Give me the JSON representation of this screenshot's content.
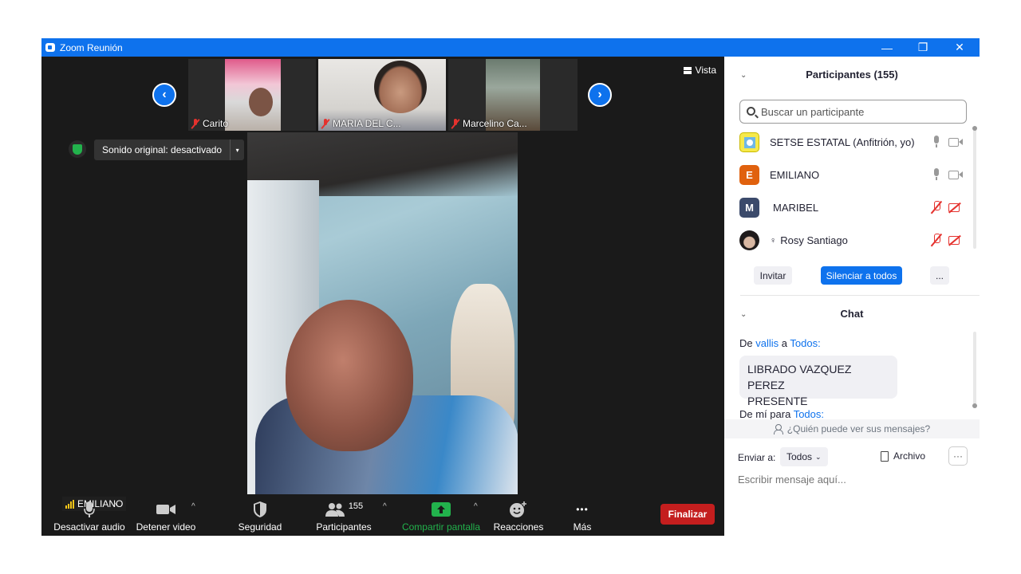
{
  "window": {
    "title": "Zoom Reunión",
    "minimize": "—",
    "restore": "❐",
    "close": "✕"
  },
  "gallery": {
    "prev": "‹",
    "next": "›",
    "thumbs": [
      {
        "name": "Carito"
      },
      {
        "name": "MARIA DEL C..."
      },
      {
        "name": "Marcelino Ca..."
      }
    ]
  },
  "view": {
    "label": "Vista"
  },
  "audio_pill": {
    "label": "Sonido original: desactivado",
    "dropdown": "▾"
  },
  "speaker": {
    "name": "EMILIANO"
  },
  "toolbar": {
    "mute": "Desactivar audio",
    "video": "Detener video",
    "security": "Seguridad",
    "participants": "Participantes",
    "participants_count": "155",
    "share": "Compartir pantalla",
    "reactions": "Reacciones",
    "more": "Más",
    "more_glyph": "•••",
    "caret": "^",
    "end": "Finalizar"
  },
  "participants_panel": {
    "title": "Participantes (155)",
    "search_placeholder": "Buscar un participante",
    "list": [
      {
        "name": "SETSE ESTATAL (Anfitrión, yo)",
        "initial": ""
      },
      {
        "name": "EMILIANO",
        "initial": "E"
      },
      {
        "name": "MARIBEL",
        "initial": "M"
      },
      {
        "name": "Rosy Santiago",
        "initial": ""
      }
    ],
    "invite": "Invitar",
    "mute_all": "Silenciar a todos",
    "more": "..."
  },
  "chat": {
    "title": "Chat",
    "msg1": {
      "prefix": "De",
      "from": "vallis",
      "mid": "a",
      "to": "Todos:",
      "text_l1": "LIBRADO VAZQUEZ PEREZ",
      "text_l2": "PRESENTE"
    },
    "msg2": {
      "prefix": "De mí para",
      "to": "Todos:"
    },
    "who_can_see": "¿Quién puede ver sus mensajes?",
    "send_to_label": "Enviar a:",
    "send_to_value": "Todos",
    "file": "Archivo",
    "more": "···",
    "input_placeholder": "Escribir mensaje aquí..."
  },
  "colors": {
    "brand": "#0e72ed",
    "end": "#c41e1e",
    "share": "#22b24c",
    "muted": "#e5322e",
    "avatar_E": "#e0610e",
    "avatar_M": "#3b4a6b"
  }
}
